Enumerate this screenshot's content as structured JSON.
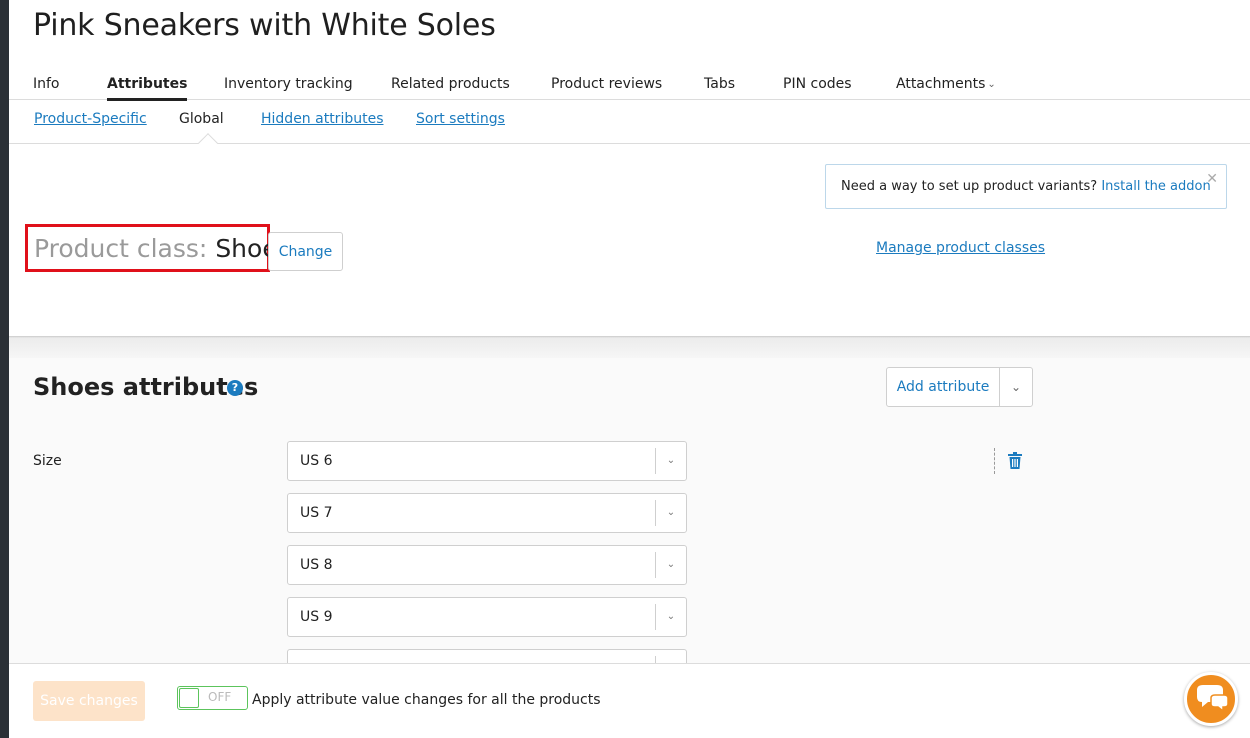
{
  "page": {
    "title": "Pink Sneakers with White Soles"
  },
  "main_tabs": [
    {
      "label": "Info"
    },
    {
      "label": "Attributes",
      "active": true
    },
    {
      "label": "Inventory tracking"
    },
    {
      "label": "Related products"
    },
    {
      "label": "Product reviews"
    },
    {
      "label": "Tabs"
    },
    {
      "label": "PIN codes"
    },
    {
      "label": "Attachments",
      "has_dropdown": true
    }
  ],
  "sub_tabs": [
    {
      "label": "Product-Specific"
    },
    {
      "label": "Global",
      "active": true
    },
    {
      "label": "Hidden attributes"
    },
    {
      "label": "Sort settings"
    }
  ],
  "notice": {
    "text": "Need a way to set up product variants?",
    "link": "Install the addon",
    "close_icon": "close-icon"
  },
  "product_class": {
    "label": "Product class:",
    "value": "Shoes",
    "change_label": "Change",
    "manage_link": "Manage product classes"
  },
  "attributes_section": {
    "title": "Shoes attributes",
    "help_icon": "?",
    "add_label": "Add attribute",
    "attributes": [
      {
        "name": "Size",
        "values": [
          "US 6",
          "US 7",
          "US 8",
          "US 9"
        ]
      }
    ]
  },
  "footer": {
    "save_label": "Save changes",
    "toggle_state": "OFF",
    "apply_label": "Apply attribute value changes for all the products"
  },
  "colors": {
    "accent": "#1b7bbf",
    "highlight_border": "#e0101a",
    "save_button": "#fde3c9",
    "chat_button": "#f08d1f",
    "toggle_border": "#5cc45c"
  }
}
